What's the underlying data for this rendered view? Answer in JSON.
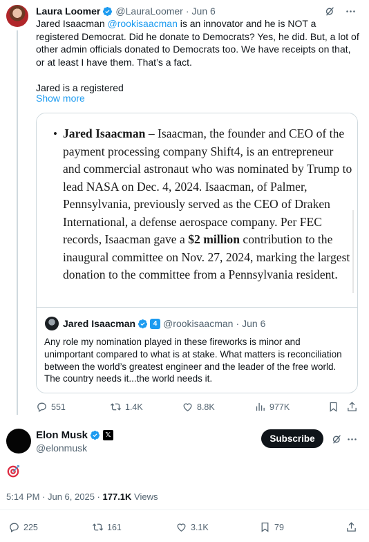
{
  "quoted_tweet": {
    "author_name": "Laura Loomer",
    "author_handle": "@LauraLoomer",
    "separator": "·",
    "date": "Jun 6",
    "text_before_mention": "Jared Isaacman ",
    "mention": "@rookisaacman",
    "text_after_mention": " is an innovator and he is NOT a registered Democrat. Did he donate to Democrats? Yes, he did. But, a lot of other admin officials donated to Democrats too. We have receipts on that, or at least I have them. That’s a fact.",
    "text_truncated": "Jared is a registered",
    "show_more_label": "Show more",
    "document_image": {
      "bullet": "•",
      "bold_name": "Jared Isaacman",
      "text_part1": " – Isaacman, the founder and CEO of the payment processing company Shift4, is an entrepreneur and commercial astronaut who was nominated by Trump to lead NASA on Dec. 4, 2024. Isaacman, of Palmer, Pennsylvania, previously served as the CEO of Draken International, a defense aerospace company. Per FEC records, Isaacman gave a ",
      "bold_amount": "$2 million",
      "text_part2": " contribution to the inaugural committee on Nov. 27, 2024, marking the largest donation to the committee from a Pennsylvania resident."
    },
    "nested_quote": {
      "author_name": "Jared Isaacman",
      "badge_label": "4",
      "author_handle": "@rookisaacman",
      "separator": "·",
      "date": "Jun 6",
      "text": "Any role my nomination played in these fireworks is minor and unimportant compared to what is at stake. What matters is reconciliation between the world’s greatest engineer and the leader of the free world. The country needs it...the world needs it."
    },
    "actions": {
      "replies": "551",
      "reposts": "1.4K",
      "likes": "8.8K",
      "views": "977K"
    }
  },
  "main_tweet": {
    "author_name": "Elon Musk",
    "badge_label": "𝕏",
    "author_handle": "@elonmusk",
    "subscribe_label": "Subscribe",
    "emoji_icon": "direct-hit-target-icon",
    "time": "5:14 PM",
    "separator": " · ",
    "date": "Jun 6, 2025",
    "views_count": "177.1K",
    "views_label": " Views",
    "actions": {
      "replies": "225",
      "reposts": "161",
      "likes": "3.1K",
      "bookmarks": "79"
    }
  },
  "colors": {
    "accent_blue": "#1d9bf0",
    "text_primary": "#0f1419",
    "text_secondary": "#536471",
    "border": "#cfd9de"
  }
}
